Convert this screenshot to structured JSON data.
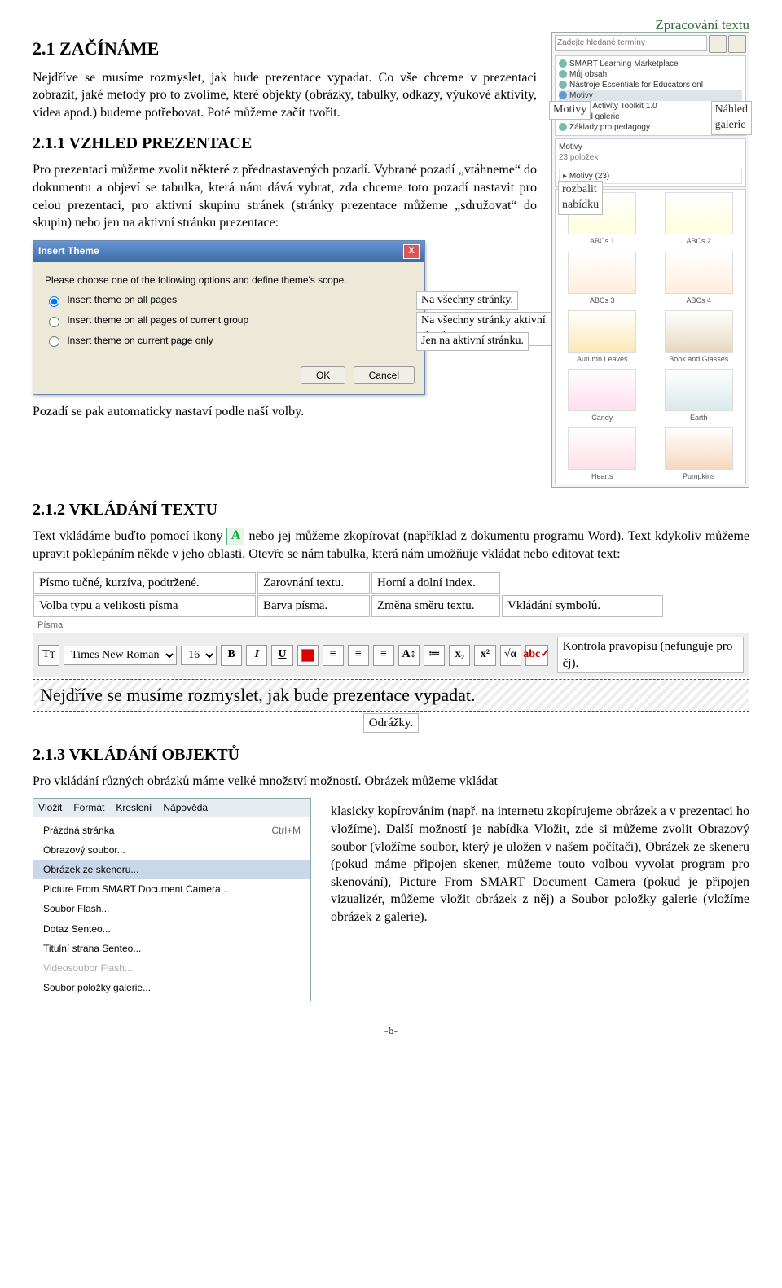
{
  "header_right": "Zpracování textu",
  "h1": {
    "num": "2.1 ",
    "caps": "Z",
    "rest": "AČÍNÁME"
  },
  "p_intro": "Nejdříve se musíme rozmyslet, jak bude prezentace vypadat. Co vše chceme v prezentaci zobrazit, jaké metody pro to zvolíme, které objekty (obrázky, tabulky, odkazy, výukové aktivity, videa apod.) budeme potřebovat. Poté můžeme začít tvořit.",
  "h211": "2.1.1 VZHLED PREZENTACE",
  "p_vzhled": "Pro prezentaci můžeme zvolit některé z přednastavených pozadí. Vybrané pozadí „vtáhneme“ do dokumentu a objeví se tabulka, která nám dává vybrat, zda chceme toto pozadí nastavit pro celou prezentaci, pro aktivní skupinu stránek (stránky prezentace můžeme „sdružovat“ do skupin) nebo jen na aktivní stránku prezentace:",
  "gallery": {
    "search_ph": "Zadejte hledané termíny",
    "tree": [
      "SMART Learning Marketplace",
      "Můj obsah",
      "Nástroje Essentials for Educators onl",
      "Motivy",
      "…son Activity Toolkit 1.0",
      "…hled galerie",
      "Základy pro pedagogy"
    ],
    "annot_motivy": "Motivy",
    "annot_nahled": "Náhled\ngalerie",
    "section_title": "Motivy",
    "section_count": "23 položek",
    "expand_label": "Motivy (23)",
    "annot_rozbalit": "rozbalit\nnabídku",
    "thumbs": [
      {
        "label": "ABCs 1"
      },
      {
        "label": "ABCs 2"
      },
      {
        "label": "ABCs 3"
      },
      {
        "label": "ABCs 4"
      },
      {
        "label": "Autumn Leaves"
      },
      {
        "label": "Book and Glasses"
      },
      {
        "label": "Candy"
      },
      {
        "label": "Earth"
      },
      {
        "label": "Hearts"
      },
      {
        "label": "Pumpkins"
      }
    ]
  },
  "dialog": {
    "title": "Insert Theme",
    "prompt": "Please choose one of the following options and define theme's scope.",
    "opts": [
      {
        "label": "Insert theme on all pages",
        "callout": "Na všechny stránky."
      },
      {
        "label": "Insert theme on all pages of current group",
        "callout": "Na všechny stránky aktivní skupiny."
      },
      {
        "label": "Insert theme on current page only",
        "callout": "Jen na aktivní stránku."
      }
    ],
    "ok": "OK",
    "cancel": "Cancel"
  },
  "p_after_dialog": "Pozadí se pak automaticky nastaví podle naší volby.",
  "h212": "2.1.2 VKLÁDÁNÍ TEXTU",
  "p_text_a": "Text vkládáme buďto pomocí ikony ",
  "p_text_b": " nebo jej můžeme zkopírovat (například z dokumentu programu Word). Text kdykoliv můžeme upravit poklepáním někde v jeho oblasti. Otevře se nám tabulka, která nám umožňuje vkládat nebo editovat text:",
  "annot1": {
    "a": "Písmo tučné, kurzíva, podtržené.",
    "b": "Zarovnání textu.",
    "c": "Horní a dolní index.",
    "d": ""
  },
  "annot2": {
    "a": "Volba typu a velikosti písma",
    "b": "Barva písma.",
    "c": "Změna směru textu.",
    "d": "Vkládání symbolů."
  },
  "toolbar": {
    "panel_label": "Písma",
    "font_name": "Times New Roman",
    "font_size": "16",
    "spellcheck_note": "Kontrola pravopisu (nefunguje pro čj)."
  },
  "example_line": "Nejdříve se musíme rozmyslet, jak bude prezentace vypadat.",
  "odrazky": "Odrážky.",
  "h213": "2.1.3 VKLÁDÁNÍ OBJEKTŮ",
  "p_obj_lead": "Pro vkládání různých obrázků máme velké množství možností. Obrázek můžeme vkládat",
  "menu": {
    "bar": [
      "Vložit",
      "Formát",
      "Kreslení",
      "Nápověda"
    ],
    "items": [
      {
        "label": "Prázdná stránka",
        "accel": "Ctrl+M"
      },
      {
        "label": "Obrazový soubor..."
      },
      {
        "label": "Obrázek ze skeneru...",
        "sel": true
      },
      {
        "label": "Picture From SMART Document Camera..."
      },
      {
        "label": "Soubor Flash..."
      },
      {
        "label": "Dotaz Senteo..."
      },
      {
        "label": "Titulní strana Senteo..."
      },
      {
        "label": "Videosoubor Flash...",
        "disabled": true
      },
      {
        "label": "Soubor položky galerie..."
      }
    ]
  },
  "p_obj_right": "klasicky kopírováním (např. na internetu zkopírujeme obrázek a v prezentaci ho vložíme). Další možností je nabídka Vložit, zde si můžeme zvolit Obrazový soubor (vložíme soubor, který je uložen v našem počítači), Obrázek ze skeneru (pokud máme připojen skener, můžeme touto volbou vyvolat program pro skenování), Picture From SMART Document Camera (pokud je připojen vizualizér, můžeme vložit obrázek z něj) a Soubor položky galerie (vložíme obrázek z galerie).",
  "page_num": "-6-"
}
